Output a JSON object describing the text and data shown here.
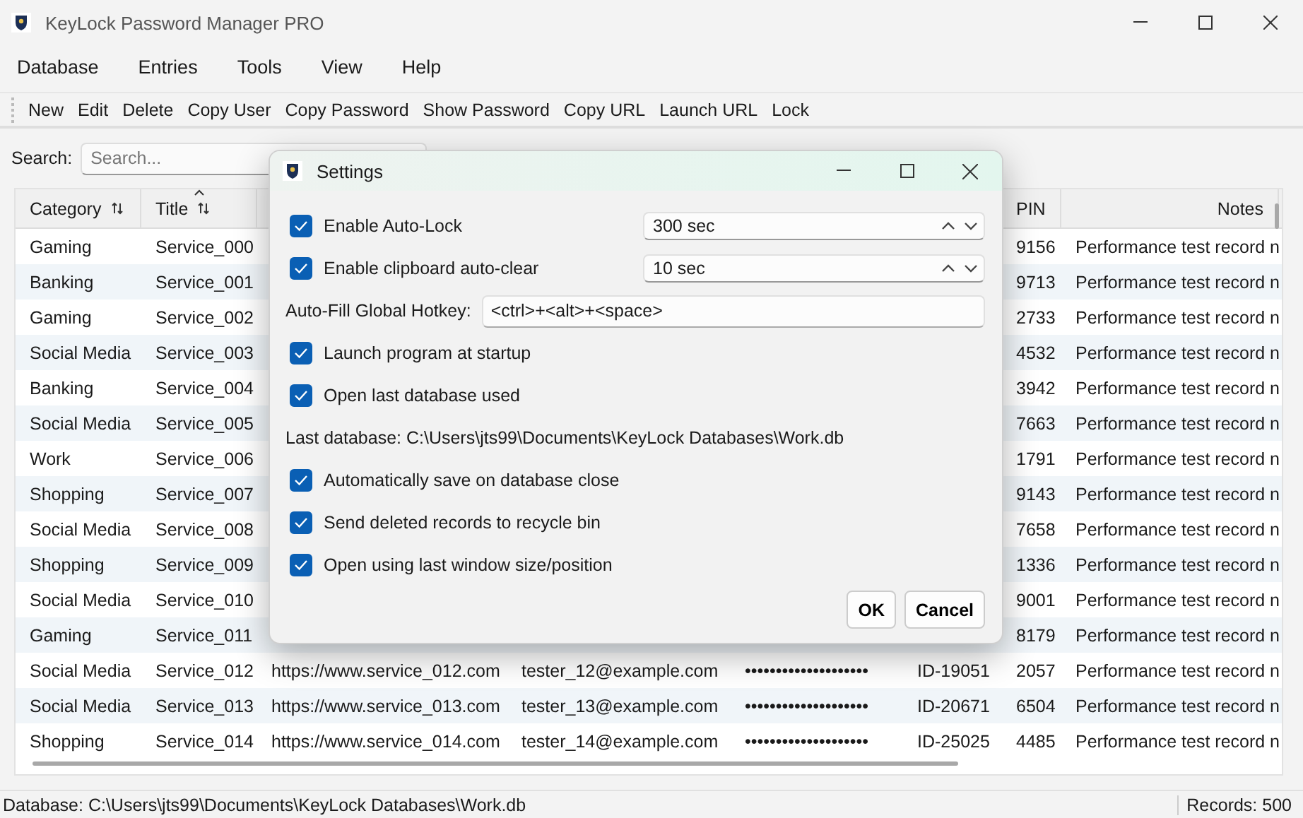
{
  "window": {
    "title": "KeyLock Password Manager PRO"
  },
  "menu": [
    "Database",
    "Entries",
    "Tools",
    "View",
    "Help"
  ],
  "toolbar": [
    "New",
    "Edit",
    "Delete",
    "Copy User",
    "Copy Password",
    "Show Password",
    "Copy URL",
    "Launch URL",
    "Lock"
  ],
  "search": {
    "label": "Search:",
    "placeholder": "Search..."
  },
  "table": {
    "columns": [
      {
        "label": "Category",
        "sortable": true,
        "sorted": false
      },
      {
        "label": "Title",
        "sortable": true,
        "sorted": true
      },
      {},
      {},
      {},
      {},
      {
        "label": "PIN",
        "sortable": false,
        "sorted": false
      },
      {
        "label": "Notes",
        "sortable": false,
        "sorted": false
      }
    ],
    "rows": [
      {
        "cells": [
          "Gaming",
          "Service_000",
          null,
          null,
          null,
          null,
          "9156",
          "Performance test record n"
        ]
      },
      {
        "cells": [
          "Banking",
          "Service_001",
          null,
          null,
          null,
          null,
          "9713",
          "Performance test record n"
        ]
      },
      {
        "cells": [
          "Gaming",
          "Service_002",
          null,
          null,
          null,
          null,
          "2733",
          "Performance test record n"
        ]
      },
      {
        "cells": [
          "Social Media",
          "Service_003",
          null,
          null,
          null,
          null,
          "4532",
          "Performance test record n"
        ]
      },
      {
        "cells": [
          "Banking",
          "Service_004",
          null,
          null,
          null,
          null,
          "3942",
          "Performance test record n"
        ]
      },
      {
        "cells": [
          "Social Media",
          "Service_005",
          null,
          null,
          null,
          null,
          "7663",
          "Performance test record n"
        ]
      },
      {
        "cells": [
          "Work",
          "Service_006",
          null,
          null,
          null,
          null,
          "1791",
          "Performance test record n"
        ]
      },
      {
        "cells": [
          "Shopping",
          "Service_007",
          null,
          null,
          null,
          null,
          "9143",
          "Performance test record n"
        ]
      },
      {
        "cells": [
          "Social Media",
          "Service_008",
          null,
          null,
          null,
          null,
          "7658",
          "Performance test record n"
        ]
      },
      {
        "cells": [
          "Shopping",
          "Service_009",
          null,
          null,
          null,
          null,
          "1336",
          "Performance test record n"
        ]
      },
      {
        "cells": [
          "Social Media",
          "Service_010",
          null,
          null,
          null,
          null,
          "9001",
          "Performance test record n"
        ]
      },
      {
        "cells": [
          "Gaming",
          "Service_011",
          null,
          null,
          null,
          null,
          "8179",
          "Performance test record n"
        ]
      },
      {
        "cells": [
          "Social Media",
          "Service_012",
          "https://www.service_012.com",
          "tester_12@example.com",
          "••••••••••••••••••••",
          "ID-19051",
          "2057",
          "Performance test record n"
        ]
      },
      {
        "cells": [
          "Social Media",
          "Service_013",
          "https://www.service_013.com",
          "tester_13@example.com",
          "••••••••••••••••••••",
          "ID-20671",
          "6504",
          "Performance test record n"
        ]
      },
      {
        "cells": [
          "Shopping",
          "Service_014",
          "https://www.service_014.com",
          "tester_14@example.com",
          "••••••••••••••••••••",
          "ID-25025",
          "4485",
          "Performance test record n"
        ]
      }
    ]
  },
  "status_bar": {
    "database": "Database: C:\\Users\\jts99\\Documents\\KeyLock Databases\\Work.db",
    "records": "Records: 500"
  },
  "dialog": {
    "title": "Settings",
    "items": [
      {
        "kind": "check",
        "label": "Enable Auto-Lock",
        "checked": true,
        "spin": "300 sec"
      },
      {
        "kind": "check",
        "label": "Enable clipboard auto-clear",
        "checked": true,
        "spin": "10 sec"
      },
      {
        "kind": "field",
        "label": "Auto-Fill Global Hotkey:",
        "value": "<ctrl>+<alt>+<space>"
      },
      {
        "kind": "check",
        "label": "Launch program at startup",
        "checked": true
      },
      {
        "kind": "check",
        "label": "Open last database used",
        "checked": true
      },
      {
        "kind": "info",
        "label": "Last database: C:\\Users\\jts99\\Documents\\KeyLock Databases\\Work.db"
      },
      {
        "kind": "check",
        "label": "Automatically save on database close",
        "checked": true
      },
      {
        "kind": "check",
        "label": "Send deleted records to recycle bin",
        "checked": true
      },
      {
        "kind": "check",
        "label": "Open using last window size/position",
        "checked": true
      }
    ],
    "buttons": [
      "OK",
      "Cancel"
    ]
  }
}
